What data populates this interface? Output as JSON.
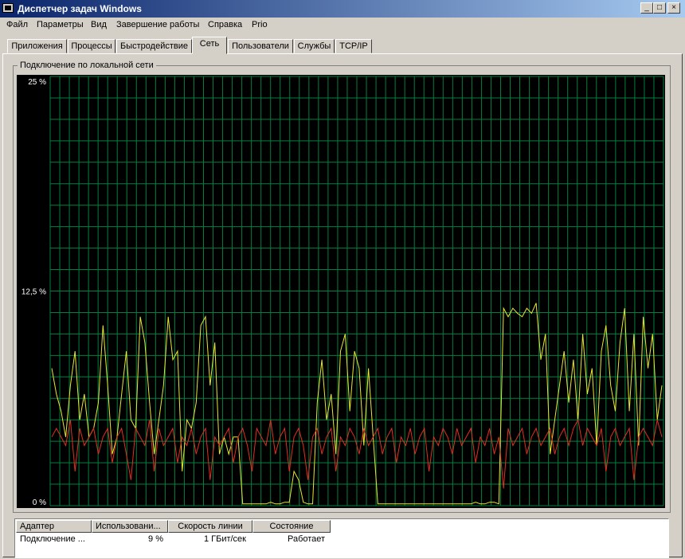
{
  "window": {
    "title": "Диспетчер задач Windows",
    "controls": {
      "minimize": "_",
      "maximize": "□",
      "close": "×"
    }
  },
  "menu": [
    "Файл",
    "Параметры",
    "Вид",
    "Завершение работы",
    "Справка",
    "Prio"
  ],
  "tabs": {
    "items": [
      "Приложения",
      "Процессы",
      "Быстродействие",
      "Сеть",
      "Пользователи",
      "Службы",
      "TCP/IP"
    ],
    "active": "Сеть"
  },
  "group": {
    "label": "Подключение по локальной сети"
  },
  "chart_data": {
    "type": "line",
    "title": "",
    "xlabel": "",
    "ylabel": "",
    "ylim": [
      0,
      25
    ],
    "yticks": [
      "25 %",
      "12,5 %",
      "0 %"
    ],
    "grid": true,
    "background": "#000000",
    "grid_color": "#008040",
    "series": [
      {
        "color": "#e8e830",
        "values": [
          8,
          6.5,
          5.5,
          4,
          7,
          9,
          5,
          6.5,
          4,
          4.5,
          6,
          10.5,
          7,
          3,
          4,
          6.5,
          9,
          5,
          4.5,
          11,
          9.5,
          6,
          3,
          5,
          7,
          11,
          8.5,
          9,
          2,
          5,
          4.5,
          6,
          10.5,
          11,
          7,
          9.5,
          3,
          4,
          3,
          4,
          4,
          0.1,
          0.1,
          0.1,
          0.1,
          0.1,
          0.1,
          0.2,
          0.1,
          0.1,
          0.2,
          0.2,
          2,
          1.5,
          0.2,
          0.1,
          0.1,
          6,
          8.5,
          5,
          6.5,
          3,
          9,
          10,
          5.5,
          9,
          8,
          3.5,
          8,
          4,
          0.1,
          0.1,
          0.1,
          0.1,
          0.1,
          0.1,
          0.1,
          0.1,
          0.1,
          0.1,
          0.1,
          0.1,
          0.1,
          0.1,
          0.1,
          0.1,
          0.1,
          0.1,
          0.1,
          0.1,
          0.1,
          0.2,
          0.1,
          0.1,
          0.2,
          0.2,
          0.1,
          11.5,
          11,
          11.5,
          11.2,
          11,
          11.5,
          11.2,
          11.8,
          8.5,
          10,
          3,
          5,
          7,
          9,
          6,
          8.5,
          5,
          10,
          6.5,
          8,
          3.5,
          9,
          10.5,
          7,
          5.5,
          9.5,
          11.5,
          5.5,
          10,
          3.5,
          11,
          8,
          10,
          5,
          7
        ]
      },
      {
        "color": "#e03020",
        "values": [
          4,
          4.5,
          4,
          3.5,
          5,
          2,
          4.5,
          3.5,
          4,
          4.5,
          3,
          4,
          4.5,
          2.5,
          4,
          4.5,
          3,
          1.5,
          4.5,
          4,
          3.5,
          5,
          2,
          4.5,
          3.5,
          4,
          4.5,
          2.5,
          4,
          3.5,
          4.5,
          3,
          4,
          4.5,
          1.5,
          4,
          3.5,
          4,
          4.5,
          2.5,
          4,
          4.5,
          3.5,
          2,
          4.5,
          4,
          3.5,
          5,
          3,
          4,
          4.5,
          2,
          4,
          4.5,
          3.5,
          1.5,
          4,
          4.5,
          3,
          4,
          4.5,
          2,
          4,
          3.5,
          4.5,
          4,
          3,
          4.5,
          3.5,
          4,
          4.5,
          3,
          4,
          4.5,
          2.5,
          4,
          3.5,
          4.5,
          3,
          4,
          4.5,
          2,
          4,
          3.5,
          4.5,
          4,
          3,
          4.5,
          3.5,
          4,
          4.5,
          2.5,
          4,
          3.5,
          4.5,
          3,
          4,
          1,
          4.5,
          3.5,
          4,
          4.5,
          3,
          4,
          4.5,
          3.5,
          4,
          4.5,
          3,
          4,
          4.5,
          3.5,
          4.5,
          5,
          3.5,
          4.5,
          4,
          3.5,
          4.5,
          2,
          4,
          4.5,
          3.5,
          4,
          4.5,
          1.5,
          4,
          4.5,
          4,
          3.5,
          5,
          4
        ]
      }
    ]
  },
  "list": {
    "columns": [
      "Адаптер",
      "Использовани...",
      "Скорость линии",
      "Состояние"
    ],
    "rows": [
      {
        "adapter": "Подключение ...",
        "usage": "9 %",
        "speed": "1 ГБит/сек",
        "state": "Работает"
      }
    ]
  }
}
